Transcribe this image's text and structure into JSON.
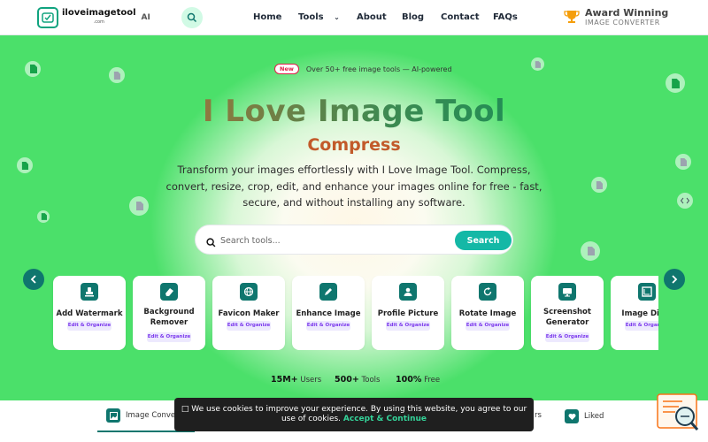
{
  "header": {
    "logo_name": "iloveimagetool",
    "logo_sub": ".com",
    "logo_ai": "AI",
    "nav": {
      "home": "Home",
      "tools": "Tools",
      "about": "About",
      "blog": "Blog",
      "contact": "Contact",
      "faqs": "FAQs"
    },
    "award_title": "Award Winning",
    "award_sub": "IMAGE CONVERTER"
  },
  "hero": {
    "badge_new": "New",
    "badge_text": "Over 50+ free image tools — AI-powered",
    "title": "I Love Image Tool",
    "subtitle": "Compress",
    "description": "Transform your images effortlessly with I Love Image Tool. Compress, convert, resize, crop, edit, and enhance your images online for free - fast, secure, and without installing any software.",
    "search_placeholder": "Search tools...",
    "search_button": "Search"
  },
  "tools": [
    {
      "label": "Add Watermark",
      "tag": "Edit & Organize",
      "icon": "stamp-icon"
    },
    {
      "label": "Background Remover",
      "tag": "Edit & Organize",
      "icon": "eraser-icon"
    },
    {
      "label": "Favicon Maker",
      "tag": "Edit & Organize",
      "icon": "globe-icon"
    },
    {
      "label": "Enhance Image",
      "tag": "Edit & Organize",
      "icon": "pen-icon"
    },
    {
      "label": "Profile Picture",
      "tag": "Edit & Organize",
      "icon": "user-icon"
    },
    {
      "label": "Rotate Image",
      "tag": "Edit & Organize",
      "icon": "rotate-icon"
    },
    {
      "label": "Screenshot Generator",
      "tag": "Edit & Organize",
      "icon": "monitor-icon"
    },
    {
      "label": "Image Dime",
      "tag": "Edit & Organize",
      "icon": "ruler-icon"
    }
  ],
  "stats": [
    {
      "value": "15M+",
      "label": "Users"
    },
    {
      "value": "500+",
      "label": "Tools"
    },
    {
      "value": "100%",
      "label": "Free"
    }
  ],
  "tabs": {
    "image": "Image Conve",
    "rs": "rs",
    "liked": "Liked"
  },
  "cookie": {
    "message": "We use cookies to improve your experience. By using this website, you agree to our use of cookies.",
    "accept": "Accept & Continue"
  },
  "colors": {
    "accent": "#14b8a6",
    "brand": "#0f766e",
    "title_orange": "#c25a2a"
  }
}
